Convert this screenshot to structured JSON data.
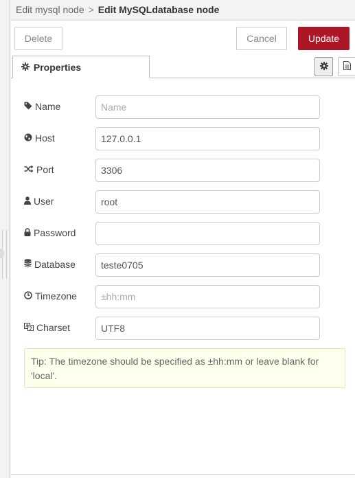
{
  "breadcrumb": {
    "parent": "Edit mysql node",
    "separator": ">",
    "current": "Edit MySQLdatabase node"
  },
  "toolbar": {
    "delete_label": "Delete",
    "cancel_label": "Cancel",
    "update_label": "Update"
  },
  "tabs": {
    "properties_label": "Properties"
  },
  "form": {
    "name": {
      "label": "Name",
      "value": "",
      "placeholder": "Name",
      "icon": "tag-icon"
    },
    "host": {
      "label": "Host",
      "value": "127.0.0.1",
      "placeholder": "",
      "icon": "globe-icon"
    },
    "port": {
      "label": "Port",
      "value": "3306",
      "placeholder": "",
      "icon": "random-icon"
    },
    "user": {
      "label": "User",
      "value": "root",
      "placeholder": "",
      "icon": "user-icon"
    },
    "password": {
      "label": "Password",
      "value": "",
      "placeholder": "",
      "icon": "lock-icon"
    },
    "database": {
      "label": "Database",
      "value": "teste0705",
      "placeholder": "",
      "icon": "database-icon"
    },
    "timezone": {
      "label": "Timezone",
      "value": "",
      "placeholder": "±hh:mm",
      "icon": "clock-icon"
    },
    "charset": {
      "label": "Charset",
      "value": "UTF8",
      "placeholder": "",
      "icon": "language-icon"
    }
  },
  "tip": "Tip: The timezone should be specified as ±hh:mm or leave blank for 'local'.",
  "colors": {
    "update_button": "#ad1625",
    "tip_background": "#ffffee"
  }
}
